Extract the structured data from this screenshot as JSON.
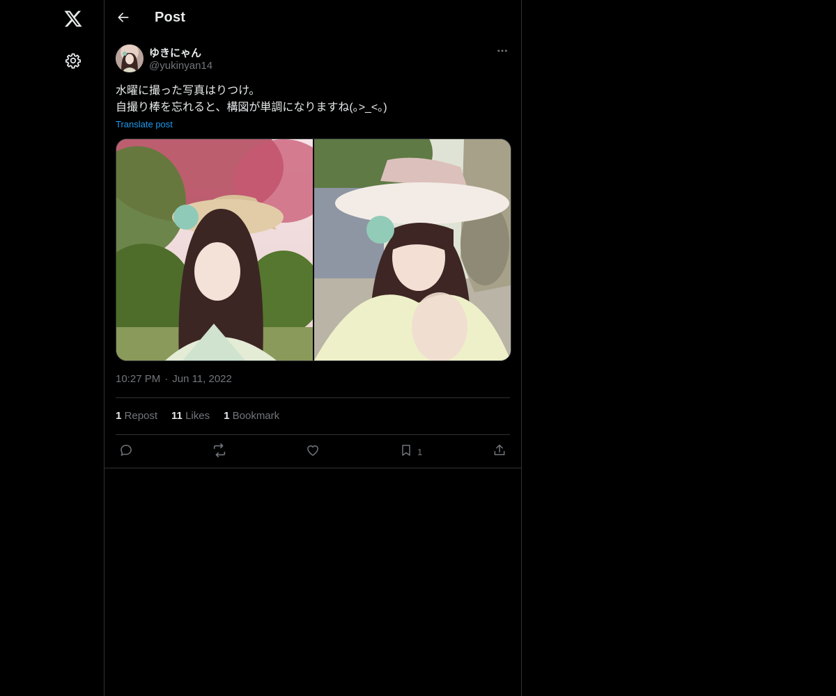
{
  "header": {
    "title": "Post"
  },
  "post": {
    "author": {
      "display_name": "ゆきにゃん",
      "handle": "@yukinyan14"
    },
    "text_lines": [
      "水曜に撮った写真はりつけ。",
      "自撮り棒を忘れると、構図が単調になりますね(｡>_<｡)"
    ],
    "translate_label": "Translate post",
    "time": "10:27 PM",
    "separator": "·",
    "date": "Jun 11, 2022",
    "stats": {
      "reposts_count": "1",
      "reposts_label": "Repost",
      "likes_count": "11",
      "likes_label": "Likes",
      "bookmarks_count": "1",
      "bookmarks_label": "Bookmark"
    },
    "actions": {
      "bookmark_count": "1"
    }
  },
  "icons": {
    "nav": [
      "x-logo-icon",
      "gear-icon"
    ],
    "header": [
      "arrow-left-icon"
    ],
    "post": [
      "more-icon",
      "reply-icon",
      "repost-icon",
      "like-icon",
      "bookmark-icon",
      "share-icon"
    ]
  },
  "colors": {
    "background": "#000000",
    "text_primary": "#e7e9ea",
    "text_secondary": "#71767b",
    "link": "#1d9bf0",
    "border": "#2f3336"
  }
}
